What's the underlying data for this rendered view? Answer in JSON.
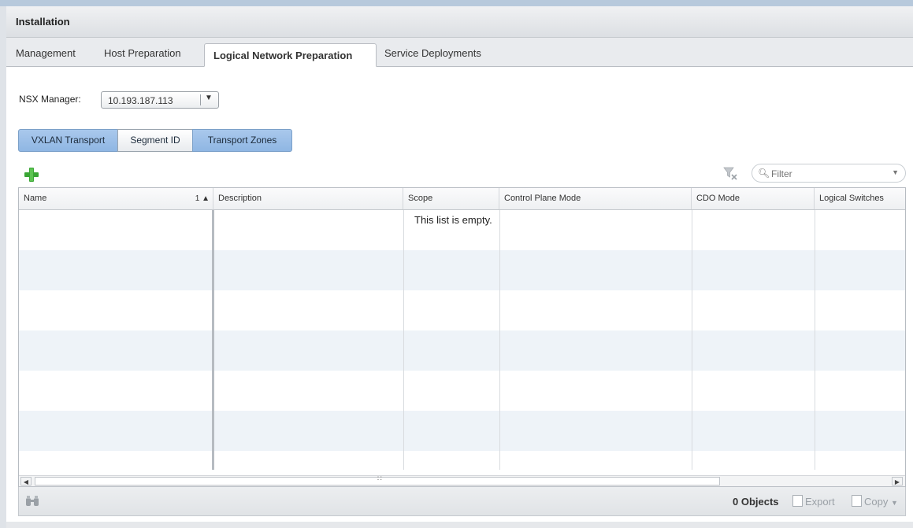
{
  "panel": {
    "title": "Installation"
  },
  "tabs": [
    {
      "label": "Management"
    },
    {
      "label": "Host Preparation"
    },
    {
      "label": "Logical Network Preparation"
    },
    {
      "label": "Service Deployments"
    }
  ],
  "nsx_manager": {
    "label": "NSX Manager:",
    "value": "10.193.187.113"
  },
  "segments": [
    {
      "label": "VXLAN Transport"
    },
    {
      "label": "Segment ID"
    },
    {
      "label": "Transport Zones"
    }
  ],
  "filter": {
    "placeholder": "Filter"
  },
  "table": {
    "columns": [
      {
        "label": "Name",
        "sort": "1 ▲"
      },
      {
        "label": "Description"
      },
      {
        "label": "Scope"
      },
      {
        "label": "Control Plane Mode"
      },
      {
        "label": "CDO Mode"
      },
      {
        "label": "Logical Switches"
      }
    ],
    "empty_message": "This list is empty."
  },
  "footer": {
    "count": "0 Objects",
    "export_label": "Export",
    "copy_label": "Copy"
  },
  "icons": {
    "add": "plus-icon",
    "clear_filter": "filter-clear-icon",
    "search": "search-icon",
    "find": "binoculars-icon"
  },
  "colors": {
    "selected_segment": "#a9c8ec",
    "add_icon": "#3aa635",
    "alt_row": "#eef3f8"
  }
}
